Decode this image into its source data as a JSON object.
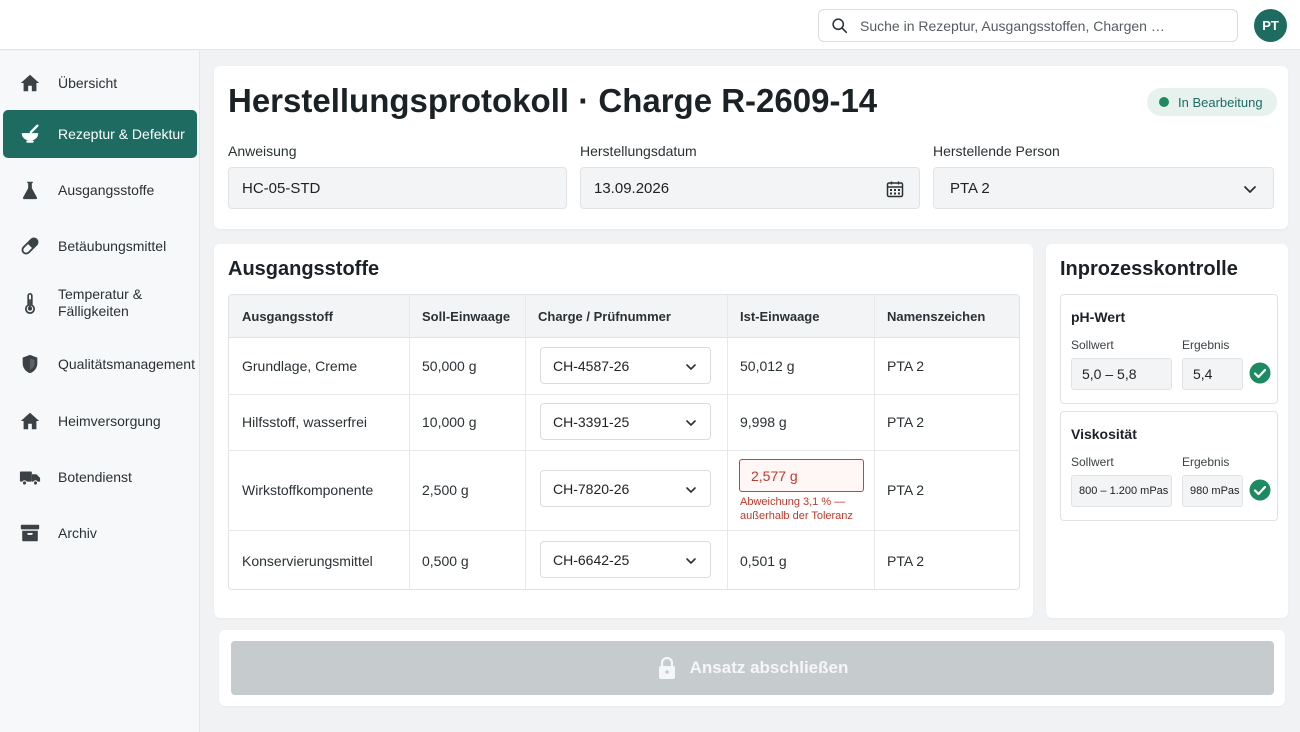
{
  "header": {
    "search_placeholder": "Suche in Rezeptur, Ausgangsstoffen, Chargen …",
    "avatar_initials": "PT"
  },
  "sidebar": {
    "items": [
      {
        "label": "Übersicht",
        "icon": "home-icon"
      },
      {
        "label": "Rezeptur & Defektur",
        "icon": "mortar-pestle-icon",
        "active": true
      },
      {
        "label": "Ausgangsstoffe",
        "icon": "flask-icon"
      },
      {
        "label": "Betäubungsmittel",
        "icon": "pill-icon"
      },
      {
        "label": "Temperatur & Fälligkeiten",
        "icon": "thermometer-icon"
      },
      {
        "label": "Qualitätsmanagement",
        "icon": "shield-icon"
      },
      {
        "label": "Heimversorgung",
        "icon": "home-icon"
      },
      {
        "label": "Botendienst",
        "icon": "truck-icon"
      },
      {
        "label": "Archiv",
        "icon": "archive-icon"
      }
    ]
  },
  "protocol": {
    "title": "Herstellungsprotokoll · Charge R-2609-14",
    "status": "In Bearbeitung",
    "fields": {
      "anweisung_label": "Anweisung",
      "anweisung_value": "HC-05-STD",
      "datum_label": "Herstellungsdatum",
      "datum_value": "13.09.2026",
      "person_label": "Herstellende Person",
      "person_value": "PTA 2"
    }
  },
  "ausgangsstoffe": {
    "title": "Ausgangsstoffe",
    "columns": [
      "Ausgangsstoff",
      "Soll-Einwaage",
      "Charge / Prüfnummer",
      "Ist-Einwaage",
      "Namenszeichen"
    ],
    "rows": [
      {
        "stoff": "Grundlage, Creme",
        "soll": "50,000 g",
        "charge": "CH-4587-26",
        "ist": "50,012 g",
        "zeichen": "PTA 2"
      },
      {
        "stoff": "Hilfsstoff, wasserfrei",
        "soll": "10,000 g",
        "charge": "CH-3391-25",
        "ist": "9,998 g",
        "zeichen": "PTA 2"
      },
      {
        "stoff": "Wirkstoffkomponente",
        "soll": "2,500 g",
        "charge": "CH-7820-26",
        "ist": "2,577 g",
        "error": "Abweichung 3,1 % — außerhalb der Toleranz",
        "zeichen": "PTA 2"
      },
      {
        "stoff": "Konservierungsmittel",
        "soll": "0,500 g",
        "charge": "CH-6642-25",
        "ist": "0,501 g",
        "zeichen": "PTA 2"
      }
    ]
  },
  "ipc": {
    "title": "Inprozesskontrolle",
    "checks": [
      {
        "name": "pH-Wert",
        "soll_label": "Sollwert",
        "soll": "5,0 – 5,8",
        "ergebnis_label": "Ergebnis",
        "ergebnis": "5,4"
      },
      {
        "name": "Viskosität",
        "soll_label": "Sollwert",
        "soll": "800 – 1.200 mPas",
        "ergebnis_label": "Ergebnis",
        "ergebnis": "980 mPas"
      }
    ]
  },
  "actions": {
    "submit_label": "Ansatz abschließen"
  },
  "colors": {
    "accent": "#1e6b62",
    "error": "#d43a3a",
    "success": "#1e8a62",
    "disabled": "#c6cbce"
  }
}
